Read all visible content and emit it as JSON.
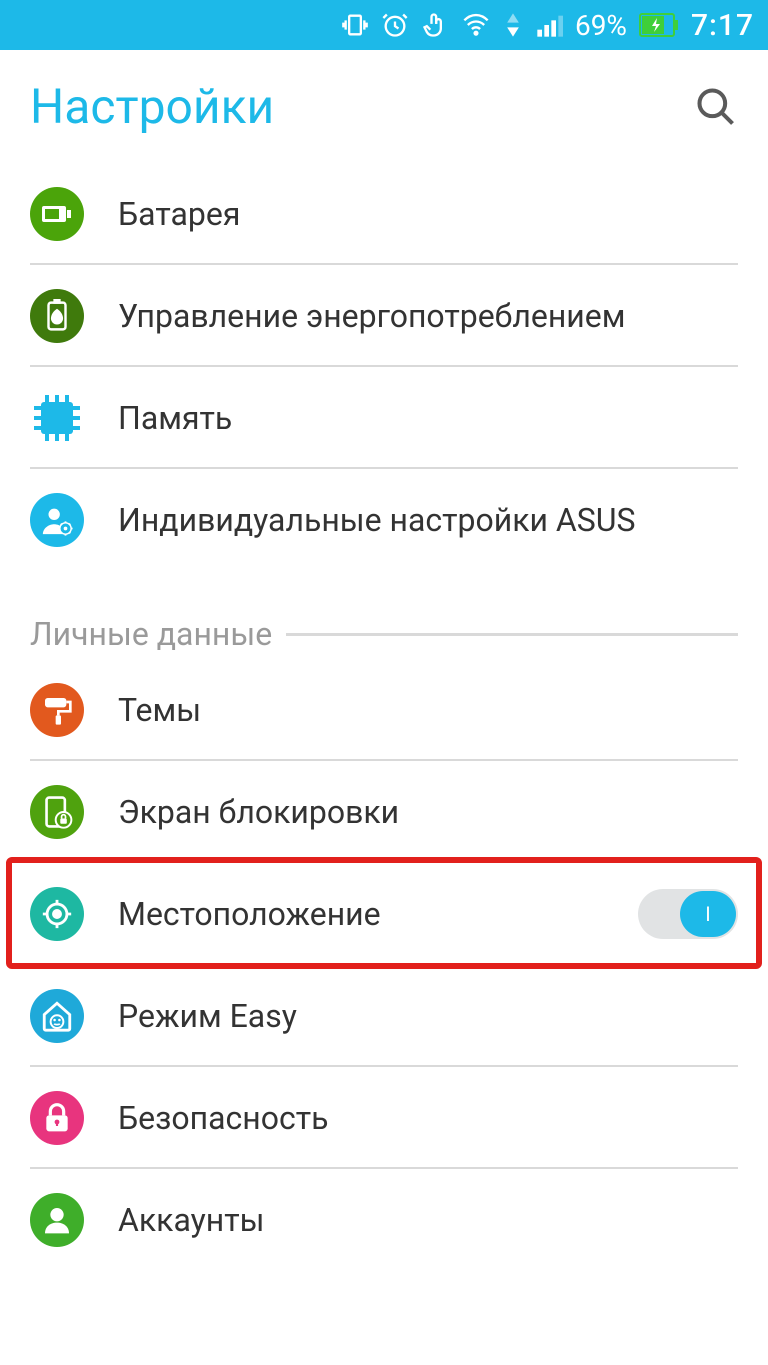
{
  "statusbar": {
    "battery_pct": "69%",
    "time": "7:17"
  },
  "header": {
    "title": "Настройки"
  },
  "section1": {
    "battery": "Батарея",
    "power": "Управление энергопотреблением",
    "memory": "Память",
    "asus": "Индивидуальные настройки ASUS"
  },
  "section_header": "Личные данные",
  "section2": {
    "themes": "Темы",
    "lockscreen": "Экран блокировки",
    "location": "Местоположение",
    "easy": "Режим Easy",
    "security": "Безопасность",
    "accounts": "Аккаунты"
  },
  "toggle_knob": "I"
}
